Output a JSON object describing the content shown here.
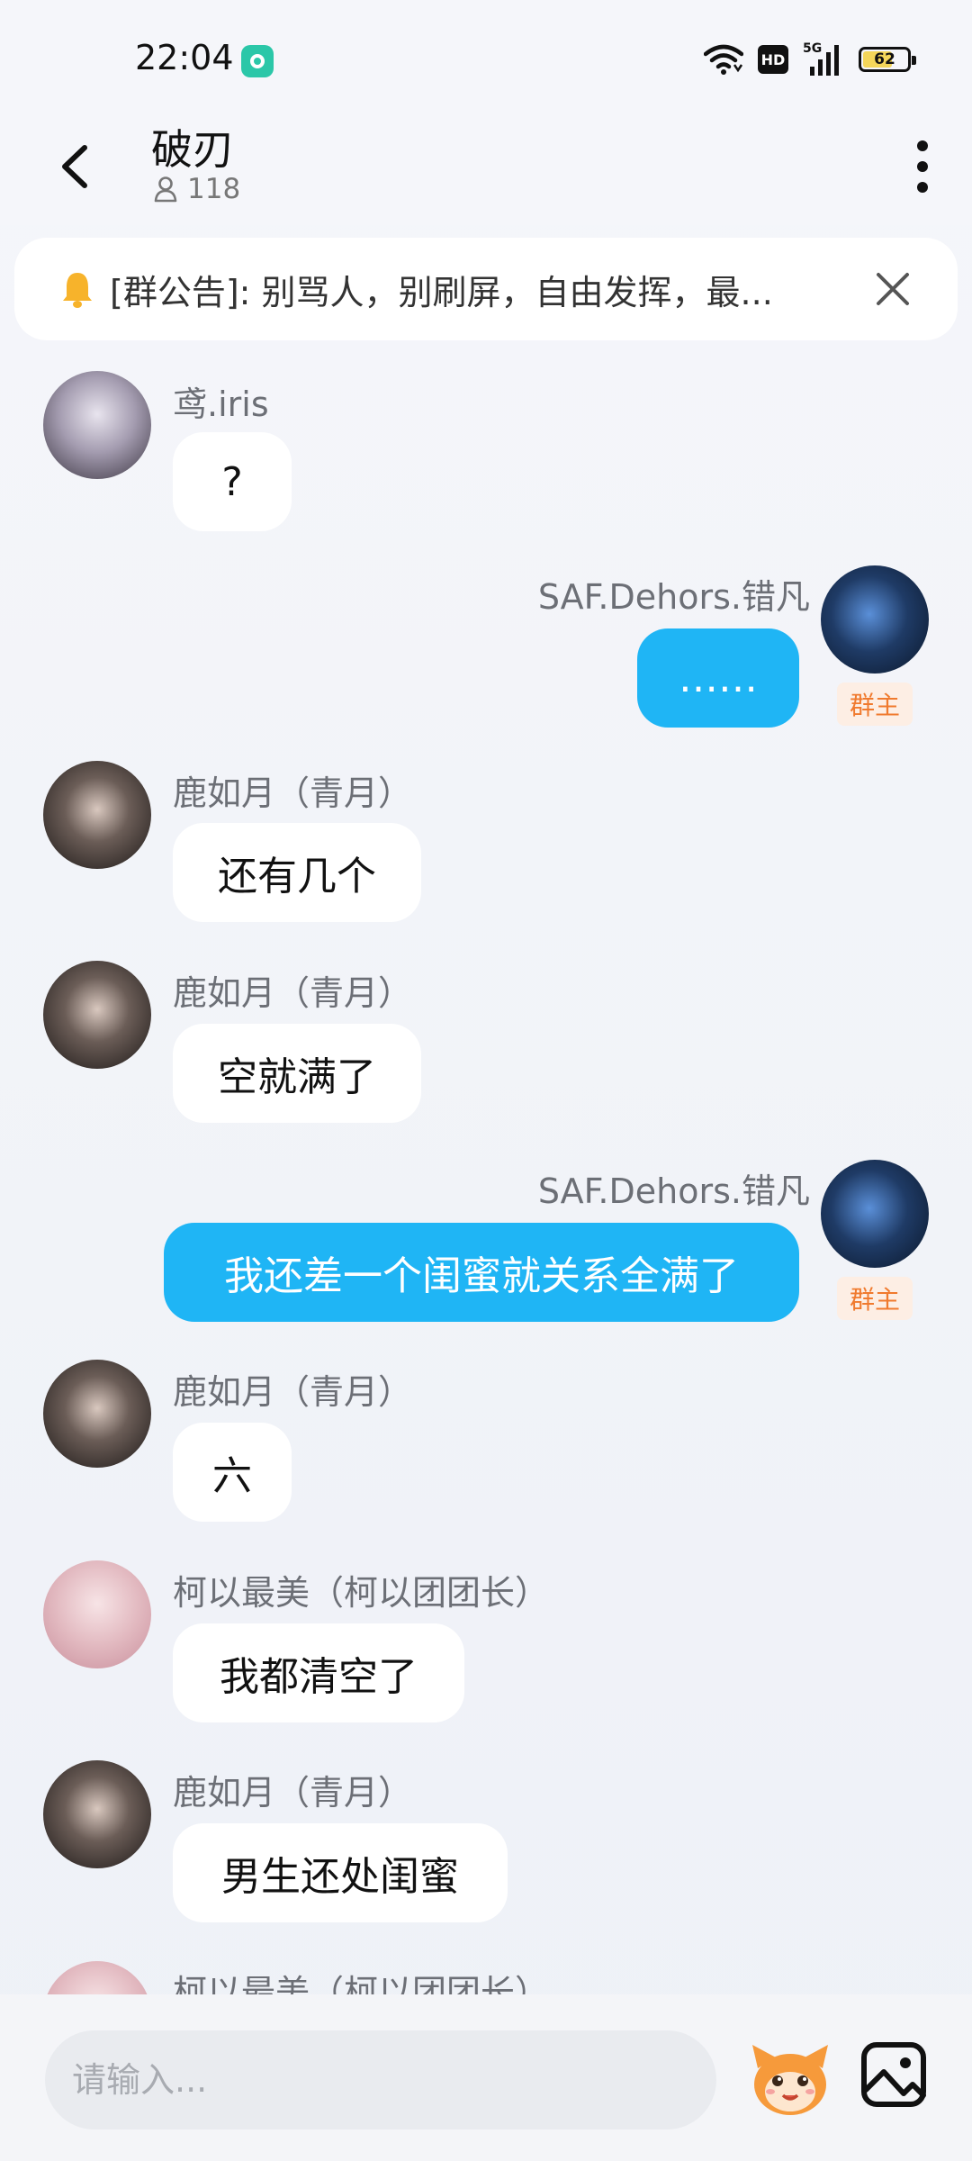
{
  "status_bar": {
    "time": "22:04",
    "hd_label": "HD",
    "network_label": "5G",
    "battery_level": "62"
  },
  "header": {
    "title": "破刃",
    "member_count": "118"
  },
  "announcement": {
    "text": "[群公告]: 别骂人，别刷屏，自由发挥，最..."
  },
  "messages": [
    {
      "side": "in",
      "sender": "鸢.iris",
      "text": "?"
    },
    {
      "side": "out",
      "sender": "SAF.Dehors.错凡",
      "text": "……",
      "badge": "群主"
    },
    {
      "side": "in",
      "sender": "鹿如月（青月）",
      "text": "还有几个"
    },
    {
      "side": "in",
      "sender": "鹿如月（青月）",
      "text": "空就满了"
    },
    {
      "side": "out",
      "sender": "SAF.Dehors.错凡",
      "text": "我还差一个闺蜜就关系全满了",
      "badge": "群主"
    },
    {
      "side": "in",
      "sender": "鹿如月（青月）",
      "text": "六"
    },
    {
      "side": "in",
      "sender": "柯以最美（柯以团团长）",
      "text": "我都清空了"
    },
    {
      "side": "in",
      "sender": "鹿如月（青月）",
      "text": "男生还处闺蜜"
    },
    {
      "side": "in",
      "sender": "柯以最美（柯以团团长）",
      "text": ""
    }
  ],
  "input": {
    "placeholder": "请输入..."
  },
  "colors": {
    "outgoing_bubble": "#1fb5f5",
    "owner_badge_text": "#f07a2e",
    "owner_badge_bg": "#fdeee4"
  }
}
